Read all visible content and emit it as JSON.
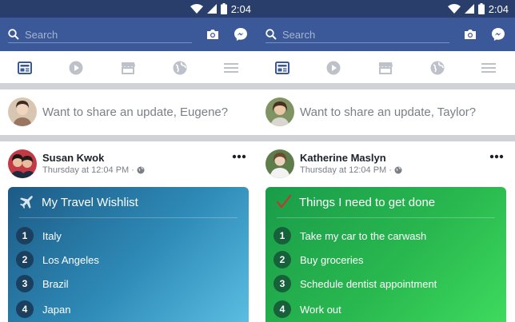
{
  "status": {
    "time": "2:04"
  },
  "search": {
    "placeholder": "Search"
  },
  "screens": [
    {
      "composer_placeholder": "Want to share an update, Eugene?",
      "post": {
        "author": "Susan Kwok",
        "timestamp": "Thursday at 12:04 PM",
        "card_icon": "airplane-icon",
        "card_title": "My Travel Wishlist",
        "items": [
          {
            "n": "1",
            "text": "Italy"
          },
          {
            "n": "2",
            "text": "Los Angeles"
          },
          {
            "n": "3",
            "text": "Brazil"
          },
          {
            "n": "4",
            "text": "Japan"
          }
        ]
      }
    },
    {
      "composer_placeholder": "Want to share an update, Taylor?",
      "post": {
        "author": "Katherine Maslyn",
        "timestamp": "Thursday at 12:04 PM",
        "card_icon": "checkmark-icon",
        "card_title": "Things I need to get done",
        "items": [
          {
            "n": "1",
            "text": "Take my car to the carwash"
          },
          {
            "n": "2",
            "text": "Buy groceries"
          },
          {
            "n": "3",
            "text": "Schedule dentist appointment"
          },
          {
            "n": "4",
            "text": "Work out"
          }
        ]
      }
    }
  ],
  "colors": {
    "brand_blue": "#3b5998",
    "status_bar": "#293e6a",
    "active_tab": "#3b5998",
    "inactive_tab": "#bdc1c9",
    "blue_card": "#2f8cb8",
    "green_card": "#29b84f"
  }
}
